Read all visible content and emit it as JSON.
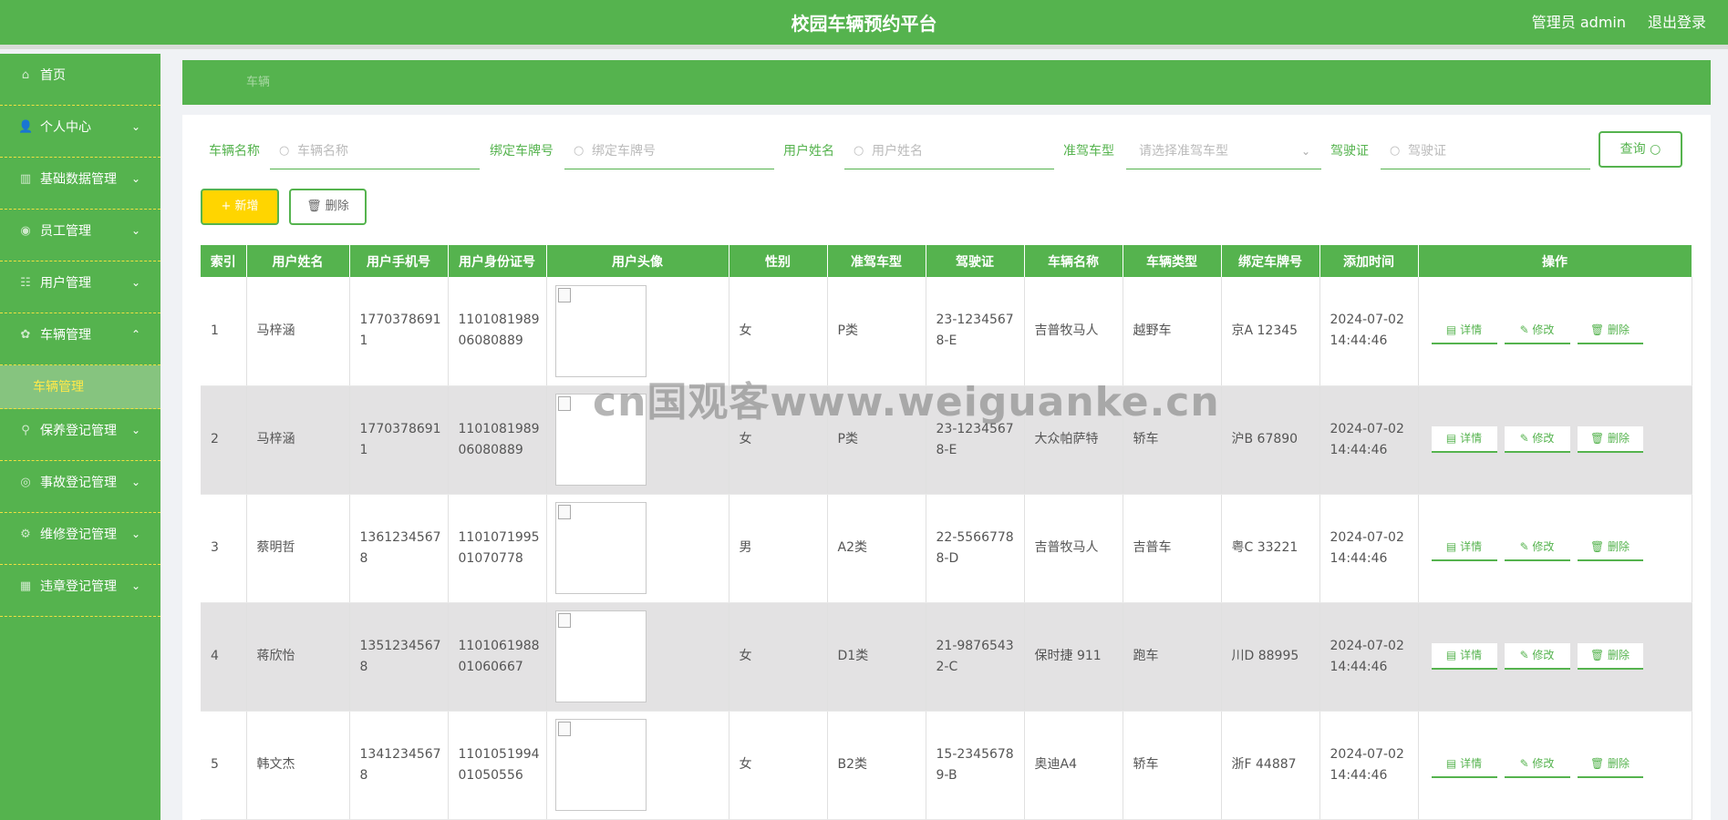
{
  "header": {
    "title": "校园车辆预约平台",
    "user": "管理员 admin",
    "logout": "退出登录"
  },
  "sidebar": {
    "items": [
      {
        "label": "首页",
        "icon": "⌂",
        "chevron": ""
      },
      {
        "label": "个人中心",
        "icon": "👤",
        "chevron": "⌄"
      },
      {
        "label": "基础数据管理",
        "icon": "▥",
        "chevron": "⌄"
      },
      {
        "label": "员工管理",
        "icon": "◉",
        "chevron": "⌄"
      },
      {
        "label": "用户管理",
        "icon": "☷",
        "chevron": "⌄"
      },
      {
        "label": "车辆管理",
        "icon": "✿",
        "chevron": "⌃"
      }
    ],
    "sub_item": "车辆管理",
    "items2": [
      {
        "label": "保养登记管理",
        "icon": "⚲",
        "chevron": "⌄"
      },
      {
        "label": "事故登记管理",
        "icon": "◎",
        "chevron": "⌄"
      },
      {
        "label": "维修登记管理",
        "icon": "⚙",
        "chevron": "⌄"
      },
      {
        "label": "违章登记管理",
        "icon": "▦",
        "chevron": "⌄"
      }
    ]
  },
  "breadcrumb": "车辆",
  "search": {
    "f1_label": "车辆名称",
    "f1_ph": "车辆名称",
    "f2_label": "绑定车牌号",
    "f2_ph": "绑定车牌号",
    "f3_label": "用户姓名",
    "f3_ph": "用户姓名",
    "f4_label": "准驾车型",
    "f4_ph": "请选择准驾车型",
    "f5_label": "驾驶证",
    "f5_ph": "驾驶证",
    "query": "查询 ○"
  },
  "actions": {
    "add": "+ 新增",
    "delete": "🗑 删除"
  },
  "table": {
    "headers": [
      "索引",
      "用户姓名",
      "用户手机号",
      "用户身份证号",
      "用户头像",
      "性别",
      "准驾车型",
      "驾驶证",
      "车辆名称",
      "车辆类型",
      "绑定车牌号",
      "添加时间",
      "操作"
    ],
    "rows": [
      {
        "idx": "1",
        "name": "马梓涵",
        "phone": "17703786911",
        "idcard": "110108198906080889",
        "gender": "女",
        "license_type": "P类",
        "license": "23-12345678-E",
        "car": "吉普牧马人",
        "car_type": "越野车",
        "plate": "京A 12345",
        "time": "2024-07-02 14:44:46"
      },
      {
        "idx": "2",
        "name": "马梓涵",
        "phone": "17703786911",
        "idcard": "110108198906080889",
        "gender": "女",
        "license_type": "P类",
        "license": "23-12345678-E",
        "car": "大众帕萨特",
        "car_type": "轿车",
        "plate": "沪B 67890",
        "time": "2024-07-02 14:44:46"
      },
      {
        "idx": "3",
        "name": "蔡明哲",
        "phone": "13612345678",
        "idcard": "110107199501070778",
        "gender": "男",
        "license_type": "A2类",
        "license": "22-55667788-D",
        "car": "吉普牧马人",
        "car_type": "吉普车",
        "plate": "粤C 33221",
        "time": "2024-07-02 14:44:46"
      },
      {
        "idx": "4",
        "name": "蒋欣怡",
        "phone": "13512345678",
        "idcard": "110106198801060667",
        "gender": "女",
        "license_type": "D1类",
        "license": "21-98765432-C",
        "car": "保时捷 911",
        "car_type": "跑车",
        "plate": "川D 88995",
        "time": "2024-07-02 14:44:46"
      },
      {
        "idx": "5",
        "name": "韩文杰",
        "phone": "13412345678",
        "idcard": "110105199401050556",
        "gender": "女",
        "license_type": "B2类",
        "license": "15-23456789-B",
        "car": "奥迪A4",
        "car_type": "轿车",
        "plate": "浙F 44887",
        "time": "2024-07-02 14:44:46"
      }
    ],
    "ops": {
      "detail": "▤ 详情",
      "edit": "✎ 修改",
      "delete": "🗑 删除"
    }
  },
  "watermark": "cn国观客www.weiguanke.cn",
  "colors": {
    "primary": "#55b34e",
    "accent": "#ffd500",
    "sub_text": "#ffe94a"
  }
}
